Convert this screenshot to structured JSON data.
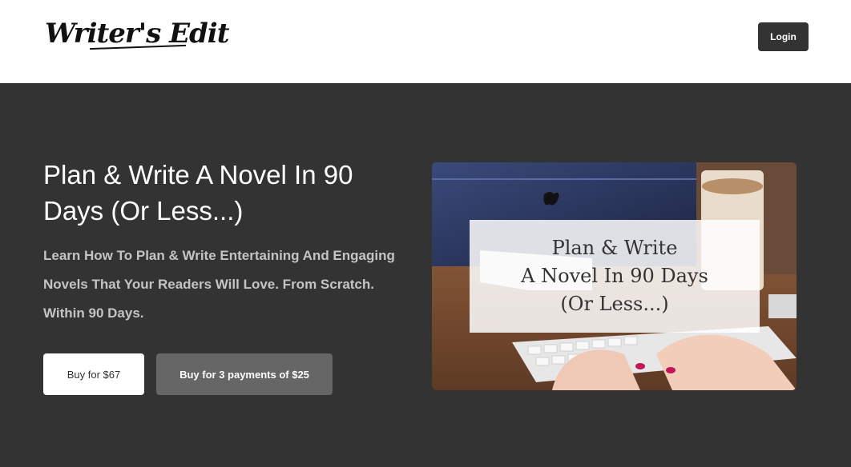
{
  "header": {
    "logo_text": "Writer's Edit",
    "login_label": "Login"
  },
  "hero": {
    "title": "Plan & Write A Novel In 90 Days (Or Less...)",
    "subtitle": "Learn How To Plan & Write Entertaining And Engaging Novels That Your Readers Will Love. From Scratch. Within 90 Days.",
    "buy_label": "Buy for $67",
    "buy_installments_label": "Buy for 3 payments of $25"
  },
  "promo_image": {
    "line1": "Plan & Write",
    "line2": "A Novel In 90 Days",
    "line3": "(Or Less...)"
  },
  "colors": {
    "header_bg": "#ffffff",
    "hero_bg": "#333333",
    "login_bg": "#333333",
    "primary_button_bg": "#ffffff",
    "secondary_button_bg": "#666666"
  }
}
